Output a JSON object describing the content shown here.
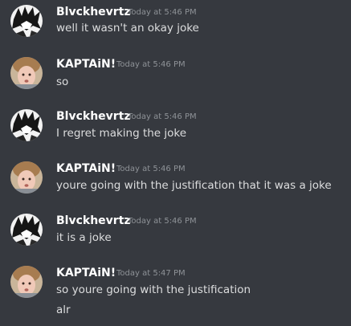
{
  "messages": [
    {
      "author": "Blvckhevrtz",
      "timestamp": "Today at 5:46 PM",
      "avatar_icon": "anime-character-avatar-icon",
      "lines": [
        "well it wasn't an okay joke"
      ]
    },
    {
      "author": "KAPTAiN!",
      "timestamp": "Today at 5:46 PM",
      "avatar_icon": "person-avatar-icon",
      "lines": [
        "so"
      ]
    },
    {
      "author": "Blvckhevrtz",
      "timestamp": "Today at 5:46 PM",
      "avatar_icon": "anime-character-avatar-icon",
      "lines": [
        "I regret making the joke"
      ]
    },
    {
      "author": "KAPTAiN!",
      "timestamp": "Today at 5:46 PM",
      "avatar_icon": "person-avatar-icon",
      "lines": [
        "youre going with the justification that it was a joke"
      ]
    },
    {
      "author": "Blvckhevrtz",
      "timestamp": "Today at 5:46 PM",
      "avatar_icon": "anime-character-avatar-icon",
      "lines": [
        "it is a joke"
      ]
    },
    {
      "author": "KAPTAiN!",
      "timestamp": "Today at 5:47 PM",
      "avatar_icon": "person-avatar-icon",
      "lines": [
        "so youre going with the justification",
        "alr"
      ]
    }
  ],
  "colors": {
    "background": "#36393f",
    "username": "#ffffff",
    "timestamp": "#8e9297",
    "message_text": "#dcddde"
  }
}
